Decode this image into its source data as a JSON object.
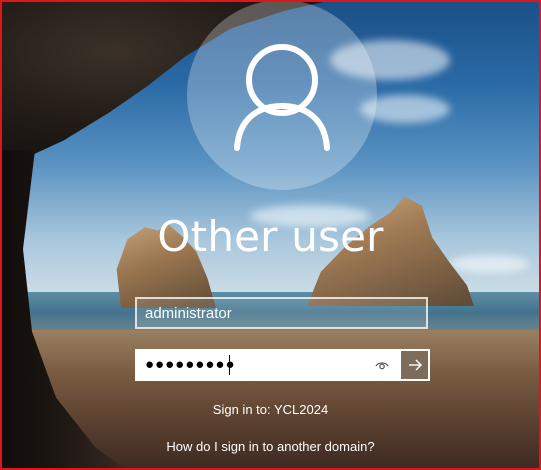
{
  "user": {
    "display_name": "Other user"
  },
  "login": {
    "username_value": "administrator",
    "password_mask": "●●●●●●●●●"
  },
  "footer": {
    "sign_in_to": "Sign in to: YCL2024",
    "domain_help_link": "How do I sign in to another domain?"
  },
  "icons": {
    "avatar": "user-icon",
    "reveal": "eye-icon",
    "submit": "arrow-right-icon"
  },
  "colors": {
    "frame_border": "#e0141a",
    "submit_button": "#7d6b5c",
    "text": "#ffffff"
  }
}
